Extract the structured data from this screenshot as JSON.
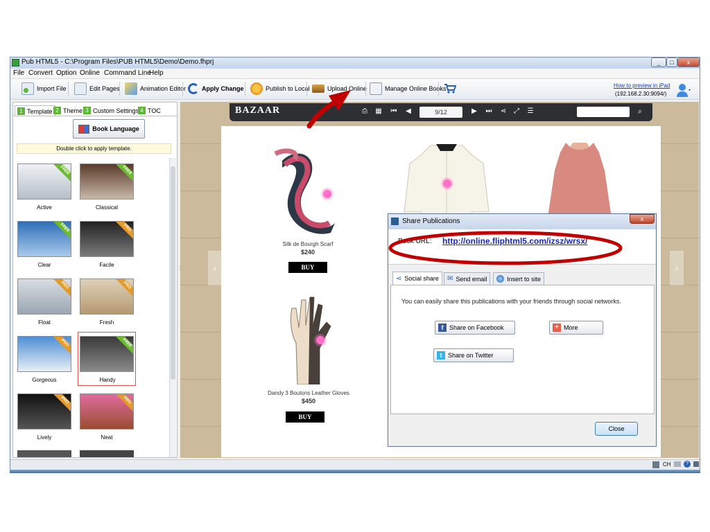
{
  "window": {
    "title": "Pub HTML5 - C:\\Program Files\\PUB HTML5\\Demo\\Demo.fhprj",
    "minimize": "_",
    "maximize": "□",
    "close": "x"
  },
  "menu": [
    "File",
    "Convert",
    "Option",
    "Online",
    "Command Line",
    "Help"
  ],
  "toolbar": {
    "import_file": "Import File",
    "edit_pages": "Edit Pages",
    "animation_editor": "Animation Editor",
    "apply_change": "Apply Change",
    "publish_local": "Publish to Local",
    "upload_online": "Upload Online",
    "manage_online": "Manage Online Books",
    "ipad_link": "How to preview in iPad",
    "ipad_addr": "(192.168.2.30:9094/)"
  },
  "left_panel": {
    "tabs": [
      {
        "num": "1",
        "label": "Template"
      },
      {
        "num": "2",
        "label": "Theme"
      },
      {
        "num": "3",
        "label": "Custom Settings"
      },
      {
        "num": "4",
        "label": "TOC"
      }
    ],
    "book_language": "Book Language",
    "hint": "Double click to apply template.",
    "templates": [
      {
        "name": "Active",
        "badge": "FREE"
      },
      {
        "name": "Classical",
        "badge": "FREE"
      },
      {
        "name": "Clear",
        "badge": "FREE"
      },
      {
        "name": "Facile",
        "badge": "PRO"
      },
      {
        "name": "Float",
        "badge": "PRO"
      },
      {
        "name": "Fresh",
        "badge": "PRO"
      },
      {
        "name": "Gorgeous",
        "badge": "PRO"
      },
      {
        "name": "Handy",
        "badge": "FREE"
      },
      {
        "name": "Lively",
        "badge": "PRO"
      },
      {
        "name": "Neat",
        "badge": "PRO"
      }
    ]
  },
  "preview": {
    "logo": "BAZAAR",
    "page_indicator": "9/12",
    "products": [
      {
        "name": "Silk de Bourgh Scarf",
        "price": "$240",
        "buy": "BUY"
      },
      {
        "name": "Dandy 3 Boutons Leather Gloves",
        "price": "$450",
        "buy": "BUY"
      }
    ]
  },
  "dialog": {
    "title": "Share Publications",
    "close_x": "x",
    "book_url_label": "Book URL:",
    "book_url": "http://online.fliphtml5.com/izsz/wrsx/",
    "tabs": [
      "Social share",
      "Send email",
      "Insert to site"
    ],
    "description": "You can easily share this publications with your friends through social networks.",
    "facebook": "Share on Facebook",
    "more": "More",
    "twitter": "Share on Twitter",
    "close": "Close"
  },
  "status": {
    "lang": "CH"
  },
  "colors": {
    "accent_green": "#5db634",
    "annotation_red": "#c00000",
    "link_blue": "#1a28b4"
  }
}
